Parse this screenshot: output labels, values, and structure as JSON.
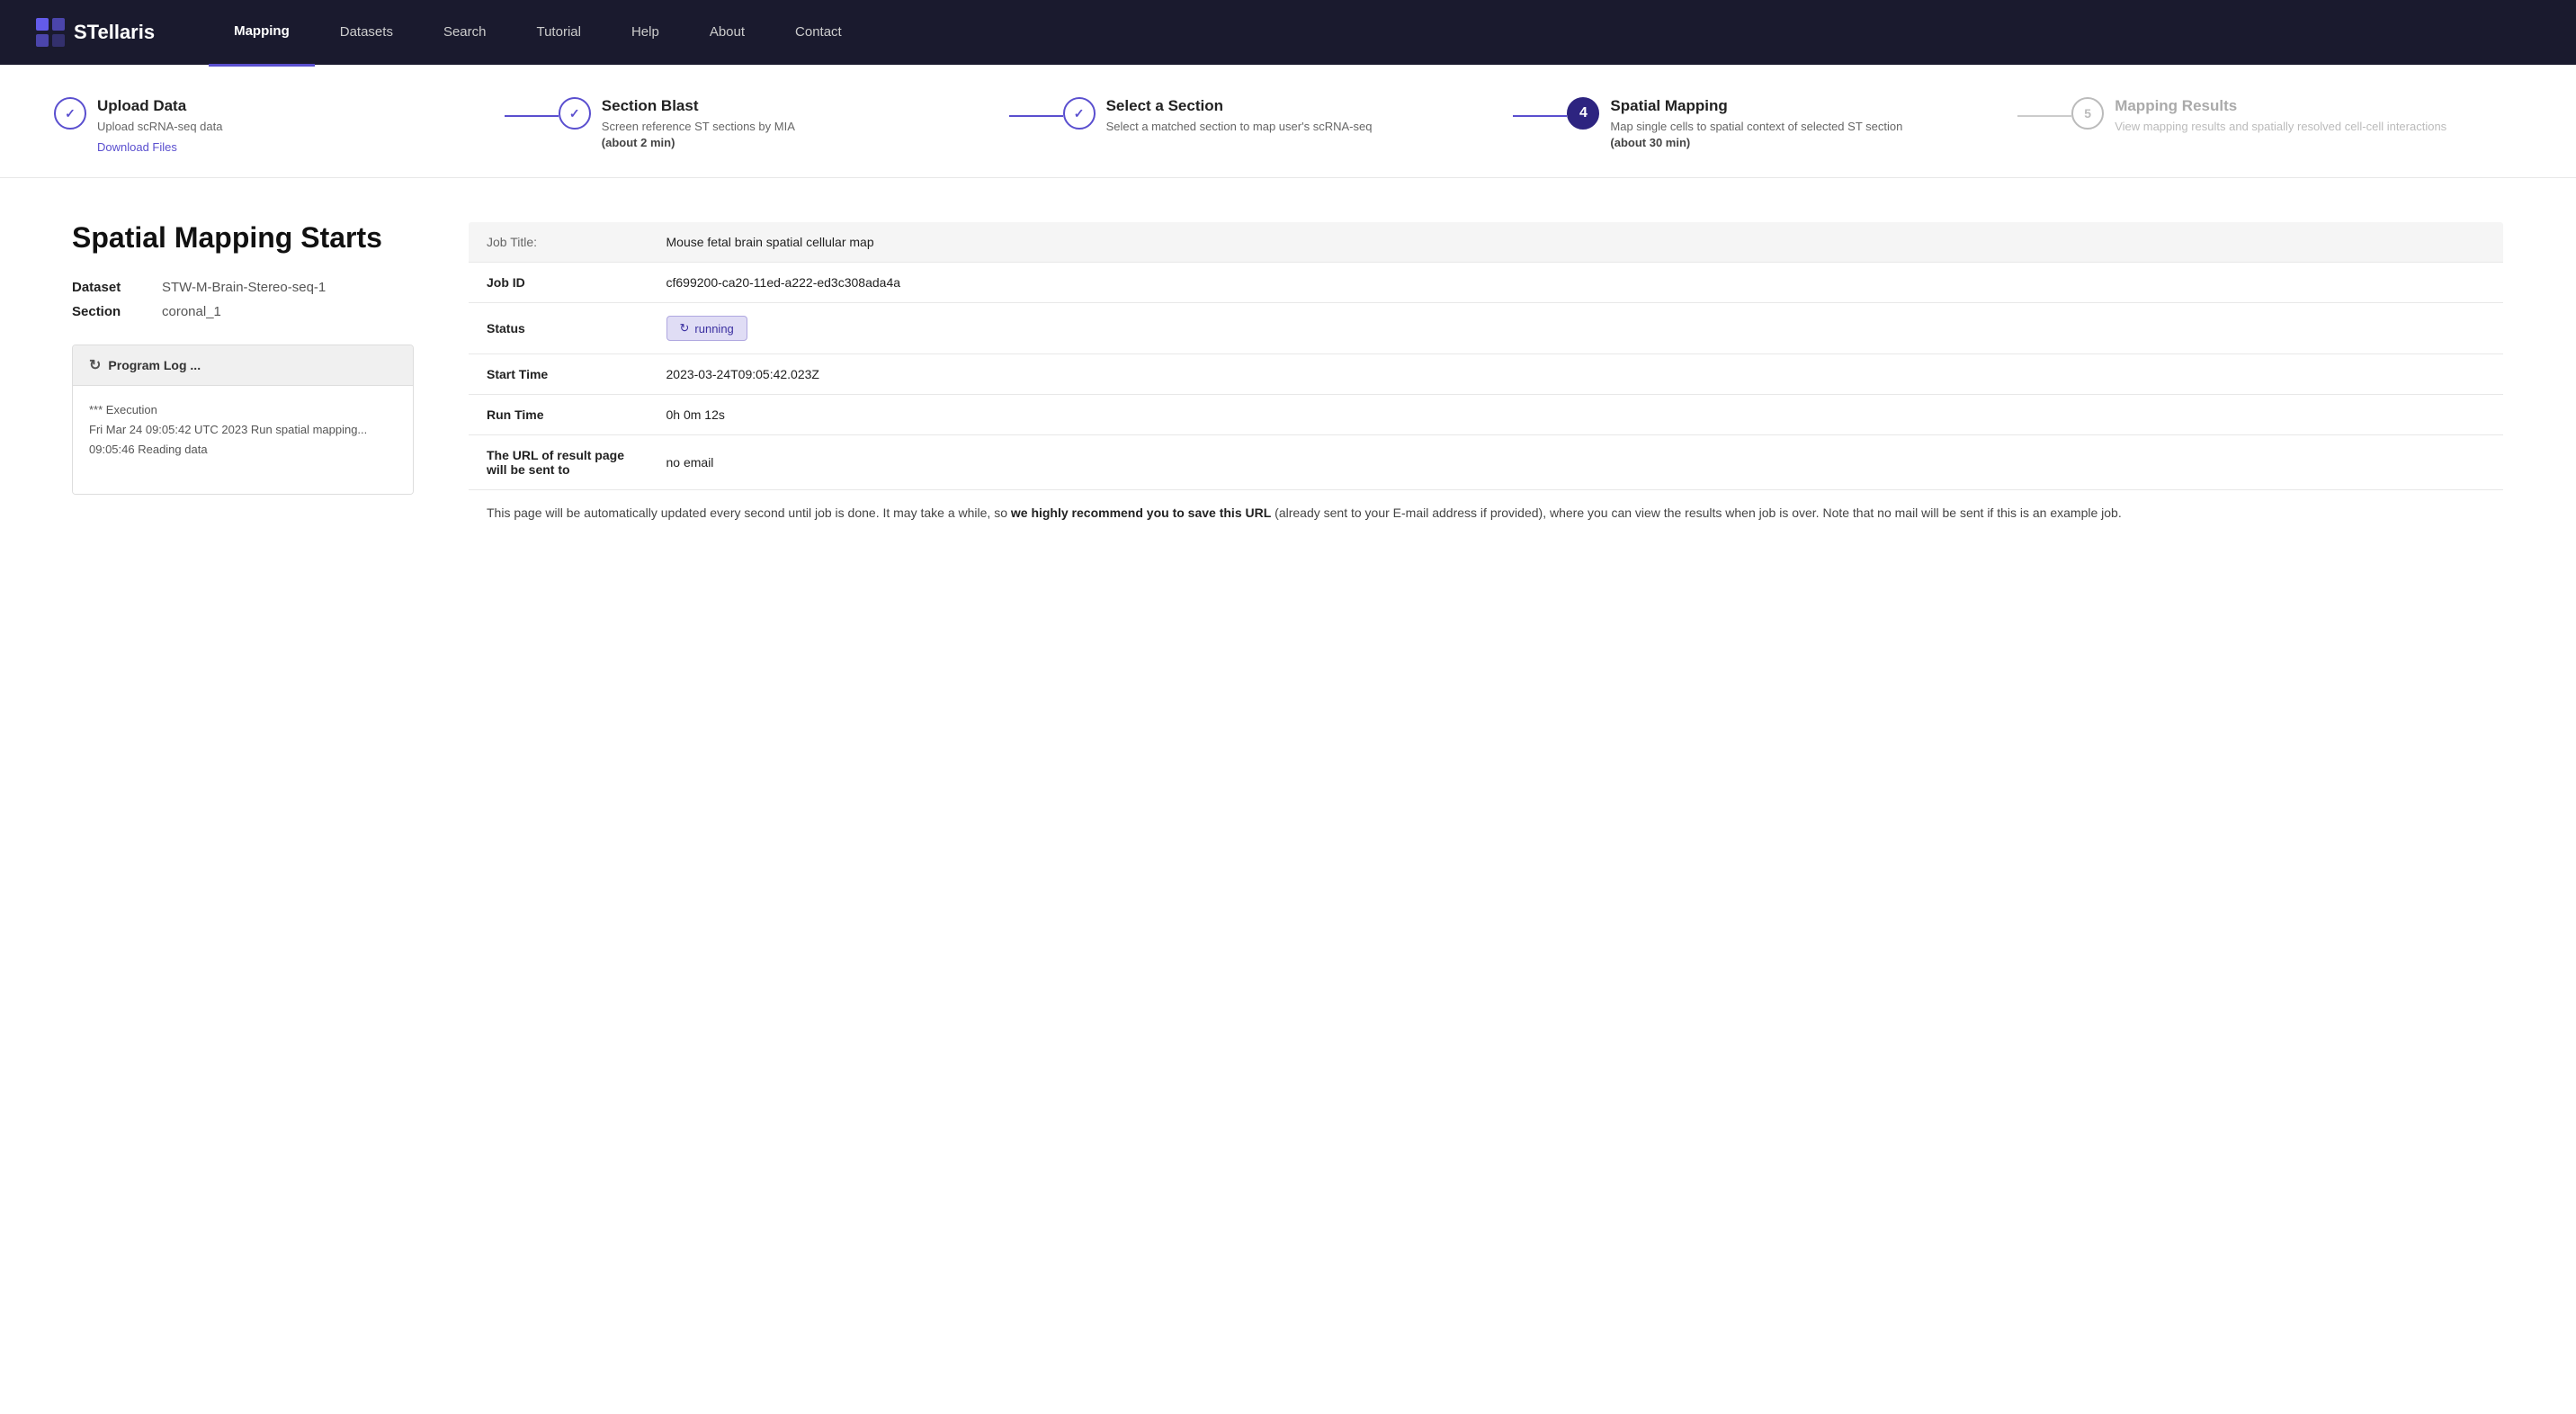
{
  "nav": {
    "logo": "STellaris",
    "links": [
      {
        "id": "mapping",
        "label": "Mapping",
        "active": true
      },
      {
        "id": "datasets",
        "label": "Datasets",
        "active": false
      },
      {
        "id": "search",
        "label": "Search",
        "active": false
      },
      {
        "id": "tutorial",
        "label": "Tutorial",
        "active": false
      },
      {
        "id": "help",
        "label": "Help",
        "active": false
      },
      {
        "id": "about",
        "label": "About",
        "active": false
      },
      {
        "id": "contact",
        "label": "Contact",
        "active": false
      }
    ]
  },
  "stepper": {
    "steps": [
      {
        "id": "upload",
        "number": "1",
        "icon": "check",
        "state": "completed",
        "title": "Upload Data",
        "desc": "Upload scRNA-seq data",
        "link": "Download Files"
      },
      {
        "id": "section-blast",
        "number": "2",
        "icon": "check",
        "state": "completed",
        "title": "Section Blast",
        "desc": "Screen reference ST sections by MIA",
        "bold": "(about 2 min)"
      },
      {
        "id": "select-section",
        "number": "3",
        "icon": "check",
        "state": "completed",
        "title": "Select a Section",
        "desc": "Select a matched section to map user's scRNA-seq"
      },
      {
        "id": "spatial-mapping",
        "number": "4",
        "icon": "4",
        "state": "active",
        "title": "Spatial Mapping",
        "desc": "Map single cells to spatial context of selected ST section",
        "bold": "(about 30 min)"
      },
      {
        "id": "mapping-results",
        "number": "5",
        "icon": "5",
        "state": "inactive",
        "title": "Mapping Results",
        "desc": "View mapping results and spatially resolved cell-cell interactions"
      }
    ]
  },
  "main": {
    "title": "Spatial Mapping Starts",
    "meta": {
      "dataset_label": "Dataset",
      "dataset_value": "STW-M-Brain-Stereo-seq-1",
      "section_label": "Section",
      "section_value": "coronal_1"
    },
    "program_log": {
      "header": "Program Log ...",
      "lines": [
        "*** Execution",
        "Fri Mar 24 09:05:42 UTC 2023 Run spatial mapping...",
        "09:05:46 Reading data"
      ]
    },
    "job_info": {
      "title_label": "Job Title:",
      "title_value": "Mouse fetal brain spatial cellular map",
      "rows": [
        {
          "label": "Job ID",
          "value": "cf699200-ca20-11ed-a222-ed3c308ada4a"
        },
        {
          "label": "Status",
          "value": "running",
          "type": "badge"
        },
        {
          "label": "Start Time",
          "value": "2023-03-24T09:05:42.023Z"
        },
        {
          "label": "Run Time",
          "value": "0h 0m 12s"
        },
        {
          "label": "The URL of result page will be sent to",
          "value": "no email"
        }
      ],
      "notice": "This page will be automatically updated every second until job is done. It may take a while, so we highly recommend you to save this URL (already sent to your E-mail address if provided), where you can view the results when job is over. Note that no mail will be sent if this is an example job.",
      "notice_bold_1": "we highly recommend you to save this URL"
    }
  }
}
